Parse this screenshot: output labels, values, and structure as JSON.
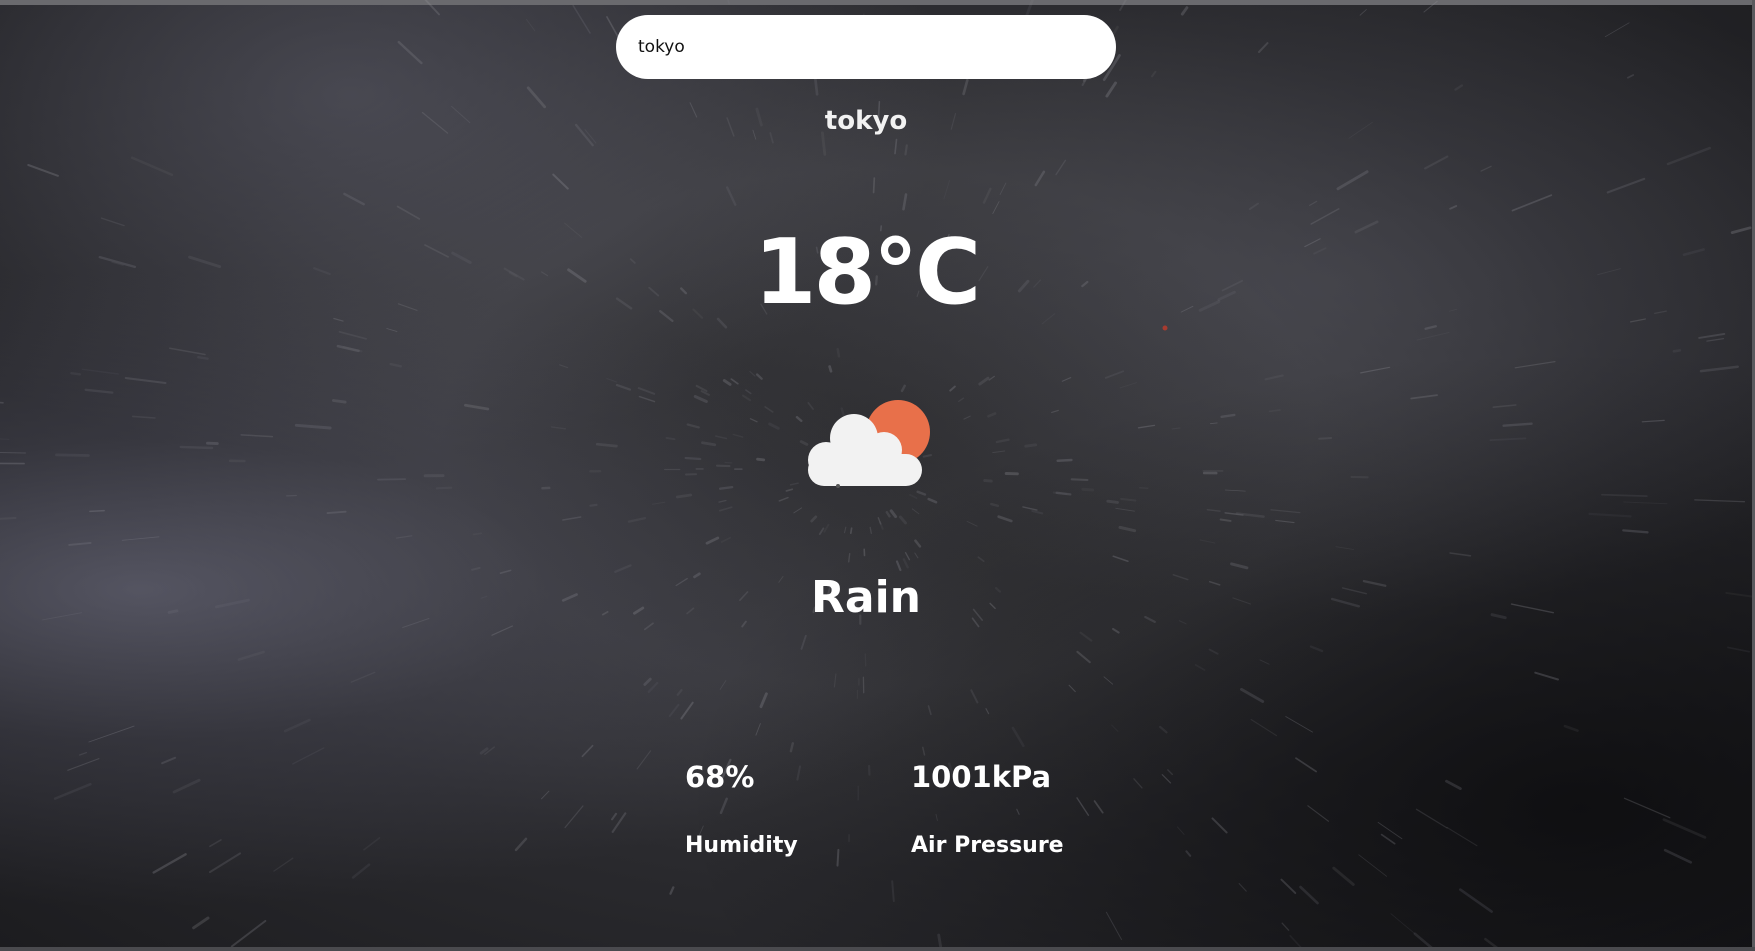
{
  "search": {
    "value": "tokyo",
    "placeholder": ""
  },
  "weather": {
    "city": "tokyo",
    "temperature": "18°C",
    "condition": "Rain",
    "icon": "partly-cloudy-icon",
    "humidity": {
      "value": "68%",
      "label": "Humidity"
    },
    "air_pressure": {
      "value": "1001kPa",
      "label": "Air Pressure"
    }
  },
  "colors": {
    "sun": "#E8704A",
    "cloud": "#F2F2F2",
    "text": "#FFFFFF"
  }
}
